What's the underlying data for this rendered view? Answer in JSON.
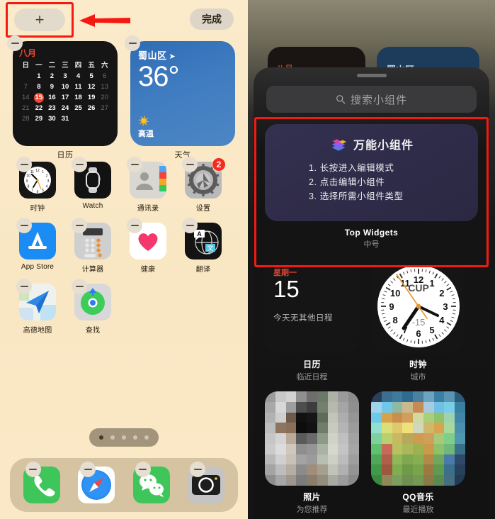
{
  "left_screen": {
    "toolbar": {
      "add_button_label": "+",
      "add_button_name": "plus-button",
      "done_button_label": "完成",
      "annotation_arrow": "red-left-arrow",
      "highlight_color": "#f51a11"
    },
    "widgets": [
      {
        "name": "日历",
        "type": "calendar",
        "month": "八月",
        "weekday_headers": [
          "日",
          "一",
          "二",
          "三",
          "四",
          "五",
          "六"
        ],
        "today": 15,
        "days": [
          {
            "d": "",
            "dim": true
          },
          {
            "d": "1"
          },
          {
            "d": "2"
          },
          {
            "d": "3"
          },
          {
            "d": "4"
          },
          {
            "d": "5"
          },
          {
            "d": "6",
            "dim": true
          },
          {
            "d": "7",
            "dim": true
          },
          {
            "d": "8"
          },
          {
            "d": "9"
          },
          {
            "d": "10"
          },
          {
            "d": "11"
          },
          {
            "d": "12"
          },
          {
            "d": "13",
            "dim": true
          },
          {
            "d": "14",
            "dim": true
          },
          {
            "d": "15",
            "today": true
          },
          {
            "d": "16"
          },
          {
            "d": "17"
          },
          {
            "d": "18"
          },
          {
            "d": "19"
          },
          {
            "d": "20",
            "dim": true
          },
          {
            "d": "21",
            "dim": true
          },
          {
            "d": "22"
          },
          {
            "d": "23"
          },
          {
            "d": "24"
          },
          {
            "d": "25"
          },
          {
            "d": "26"
          },
          {
            "d": "27",
            "dim": true
          },
          {
            "d": "28",
            "dim": true
          },
          {
            "d": "29"
          },
          {
            "d": "30"
          },
          {
            "d": "31"
          },
          {
            "d": ""
          },
          {
            "d": ""
          },
          {
            "d": ""
          }
        ]
      },
      {
        "name": "天气",
        "type": "weather",
        "city": "蜀山区",
        "location_icon": "location-arrow-icon",
        "temperature": "36°",
        "condition": "高温",
        "condition_icon": "sun-icon"
      }
    ],
    "apps": [
      [
        {
          "label": "时钟",
          "icon": "clock-app-icon"
        },
        {
          "label": "Watch",
          "icon": "watch-app-icon"
        },
        {
          "label": "通讯录",
          "icon": "contacts-app-icon"
        },
        {
          "label": "设置",
          "icon": "settings-app-icon",
          "badge": "2"
        }
      ],
      [
        {
          "label": "App Store",
          "icon": "appstore-app-icon"
        },
        {
          "label": "计算器",
          "icon": "calculator-app-icon"
        },
        {
          "label": "健康",
          "icon": "health-app-icon"
        },
        {
          "label": "翻译",
          "icon": "translate-app-icon"
        }
      ],
      [
        {
          "label": "高德地图",
          "icon": "amap-app-icon"
        },
        {
          "label": "查找",
          "icon": "findmy-app-icon"
        }
      ]
    ],
    "page_dots": {
      "count": 5,
      "active_index": 0
    },
    "dock": [
      {
        "label": "电话",
        "icon": "phone-app-icon"
      },
      {
        "label": "Safari",
        "icon": "safari-app-icon"
      },
      {
        "label": "微信",
        "icon": "wechat-app-icon"
      },
      {
        "label": "相机",
        "icon": "camera-app-icon"
      }
    ]
  },
  "right_screen": {
    "background_widgets": [
      {
        "label": "八月",
        "type": "calendar-peek"
      },
      {
        "label": "蜀山区",
        "type": "weather-peek"
      }
    ],
    "sheet": {
      "grabber": "drag-handle",
      "search": {
        "placeholder": "搜索小组件",
        "icon": "search-icon"
      },
      "featured": {
        "app_icon": "stacked-blocks-icon",
        "title": "万能小组件",
        "steps": [
          "1. 长按进入编辑模式",
          "2. 点击编辑小组件",
          "3. 选择所需小组件类型"
        ],
        "caption_name": "Top Widgets",
        "caption_size": "中号",
        "highlight_color": "#f51a11"
      },
      "widget_grid": [
        {
          "caption_name": "日历",
          "caption_sub": "临近日程",
          "type": "calendar",
          "weekday": "星期一",
          "day": "15",
          "note": "今天无其他日程"
        },
        {
          "caption_name": "时钟",
          "caption_sub": "城市",
          "type": "clock",
          "city_code": "CUP",
          "offset": "-15",
          "numerals": [
            "12",
            "1",
            "2",
            "3",
            "4",
            "5",
            "6",
            "7",
            "8",
            "9",
            "10",
            "11"
          ]
        },
        {
          "caption_name": "照片",
          "caption_sub": "为您推荐",
          "type": "photos-pixelated"
        },
        {
          "caption_name": "QQ音乐",
          "caption_sub": "最近播放",
          "type": "music-pixelated"
        }
      ]
    }
  }
}
